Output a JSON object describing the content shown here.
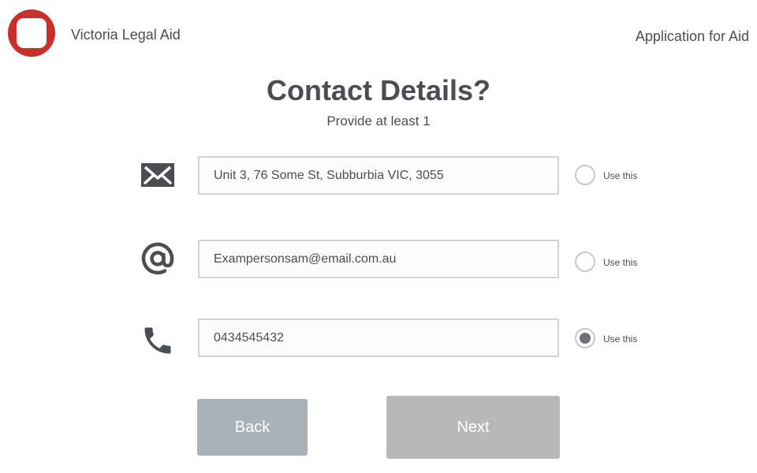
{
  "header": {
    "org_name": "Victoria Legal Aid",
    "app_title": "Application for Aid",
    "logo_color": "#c9302c"
  },
  "main": {
    "title": "Contact Details?",
    "subtitle": "Provide at least 1",
    "rows": [
      {
        "icon": "envelope-icon",
        "value": "Unit 3, 76 Some St, Subburbia VIC, 3055",
        "use_label": "Use this",
        "selected": false
      },
      {
        "icon": "at-sign-icon",
        "value": "Exampersonsam@email.com.au",
        "use_label": "Use this",
        "selected": false
      },
      {
        "icon": "phone-icon",
        "value": "0434545432",
        "use_label": "Use this",
        "selected": true
      }
    ]
  },
  "footer": {
    "back_label": "Back",
    "next_label": "Next"
  },
  "colors": {
    "text": "#4a4e52",
    "back_button": "#a9b2b8",
    "next_button": "#b8b8b8",
    "field_border": "#d3d3d3"
  }
}
